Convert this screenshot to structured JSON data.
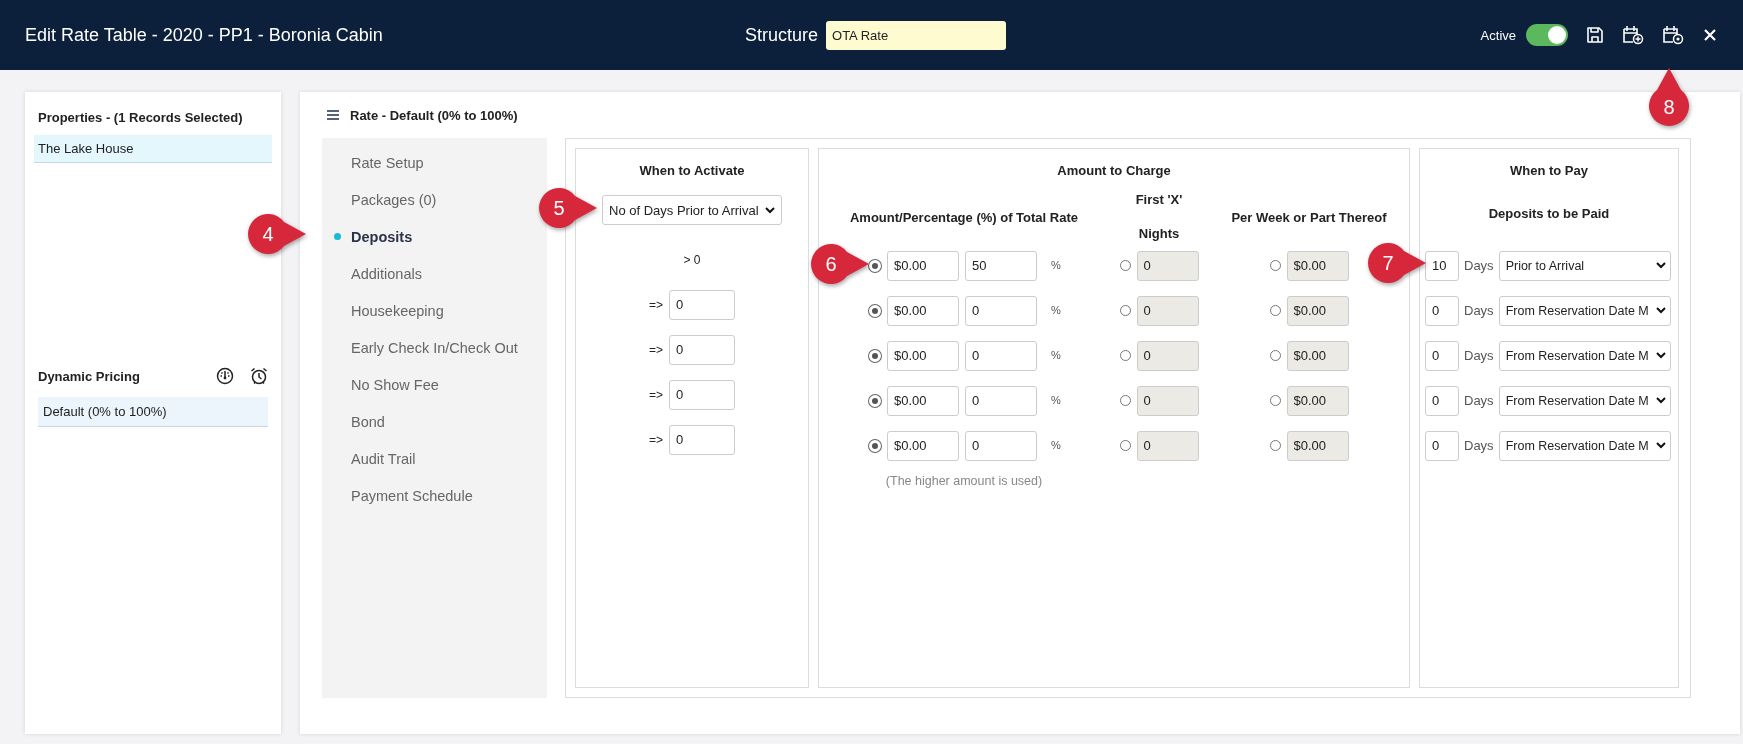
{
  "header": {
    "title": "Edit Rate Table - 2020 - PP1 - Boronia Cabin",
    "structure_label": "Structure",
    "structure_value": "OTA Rate",
    "active": {
      "label": "Active",
      "on": true
    }
  },
  "properties": {
    "title": "Properties - (1 Records Selected)",
    "items": [
      {
        "label": "The Lake House",
        "selected": true
      }
    ]
  },
  "dynamic_pricing": {
    "title": "Dynamic Pricing",
    "items": [
      {
        "label": "Default (0% to 100%)",
        "selected": true
      }
    ]
  },
  "rate": {
    "title": "Rate - Default (0% to 100%)"
  },
  "nav": [
    {
      "label": "Rate Setup",
      "selected": false
    },
    {
      "label": "Packages (0)",
      "selected": false
    },
    {
      "label": "Deposits",
      "selected": true
    },
    {
      "label": "Additionals",
      "selected": false
    },
    {
      "label": "Housekeeping",
      "selected": false
    },
    {
      "label": "Early Check In/Check Out",
      "selected": false
    },
    {
      "label": "No Show Fee",
      "selected": false
    },
    {
      "label": "Bond",
      "selected": false
    },
    {
      "label": "Audit Trail",
      "selected": false
    },
    {
      "label": "Payment Schedule",
      "selected": false
    }
  ],
  "activate": {
    "title": "When to Activate",
    "select": "No of Days Prior to Arrival",
    "rows": [
      {
        "kind": "text",
        "label": "> 0"
      },
      {
        "kind": "input",
        "prefix": "=>",
        "value": "0"
      },
      {
        "kind": "input",
        "prefix": "=>",
        "value": "0"
      },
      {
        "kind": "input",
        "prefix": "=>",
        "value": "0"
      },
      {
        "kind": "input",
        "prefix": "=>",
        "value": "0"
      }
    ]
  },
  "charge": {
    "title": "Amount to Charge",
    "amount_heading": "Amount/Percentage (%) of Total Rate",
    "nights_heading": [
      "First 'X'",
      "Nights"
    ],
    "per_week_heading": "Per Week or Part Thereof",
    "note": "(The higher amount is used)",
    "rows": [
      {
        "amount": {
          "selected": true,
          "value": "$0.00",
          "percent": "50",
          "unit": "%"
        },
        "nights": {
          "selected": false,
          "value": "0",
          "disabled": true
        },
        "per_week": {
          "selected": false,
          "value": "$0.00",
          "disabled": true
        }
      },
      {
        "amount": {
          "selected": true,
          "value": "$0.00",
          "percent": "0",
          "unit": "%"
        },
        "nights": {
          "selected": false,
          "value": "0",
          "disabled": true
        },
        "per_week": {
          "selected": false,
          "value": "$0.00",
          "disabled": true
        }
      },
      {
        "amount": {
          "selected": true,
          "value": "$0.00",
          "percent": "0",
          "unit": "%"
        },
        "nights": {
          "selected": false,
          "value": "0",
          "disabled": true
        },
        "per_week": {
          "selected": false,
          "value": "$0.00",
          "disabled": true
        }
      },
      {
        "amount": {
          "selected": true,
          "value": "$0.00",
          "percent": "0",
          "unit": "%"
        },
        "nights": {
          "selected": false,
          "value": "0",
          "disabled": true
        },
        "per_week": {
          "selected": false,
          "value": "$0.00",
          "disabled": true
        }
      },
      {
        "amount": {
          "selected": true,
          "value": "$0.00",
          "percent": "0",
          "unit": "%"
        },
        "nights": {
          "selected": false,
          "value": "0",
          "disabled": true
        },
        "per_week": {
          "selected": false,
          "value": "$0.00",
          "disabled": true
        }
      }
    ]
  },
  "pay": {
    "title": "When to Pay",
    "subtitle": "Deposits to be Paid",
    "rows": [
      {
        "days": "10",
        "unit": "Days",
        "option": "Prior to Arrival"
      },
      {
        "days": "0",
        "unit": "Days",
        "option": "From Reservation Date M"
      },
      {
        "days": "0",
        "unit": "Days",
        "option": "From Reservation Date M"
      },
      {
        "days": "0",
        "unit": "Days",
        "option": "From Reservation Date M"
      },
      {
        "days": "0",
        "unit": "Days",
        "option": "From Reservation Date M"
      }
    ]
  },
  "callouts": [
    {
      "label": "4"
    },
    {
      "label": "5"
    },
    {
      "label": "6"
    },
    {
      "label": "7"
    },
    {
      "label": "8"
    }
  ]
}
